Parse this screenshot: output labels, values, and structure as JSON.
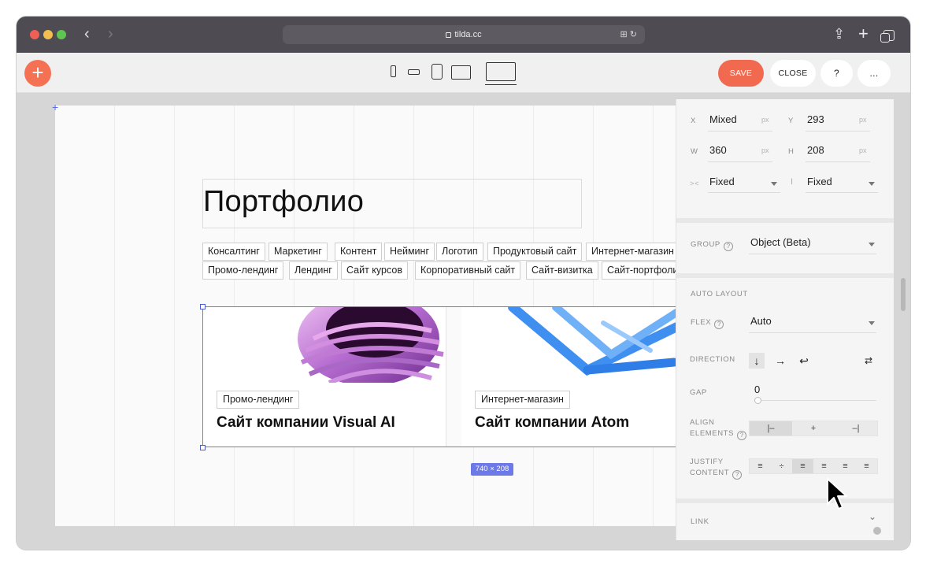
{
  "browser": {
    "url": "tilda.cc",
    "back_glyph": "‹",
    "forward_glyph": "›",
    "right_icons": "⊞ ↻",
    "share_glyph": "⇪",
    "newtab_glyph": "+"
  },
  "toolbar": {
    "add_glyph": "+",
    "save_label": "SAVE",
    "close_label": "CLOSE",
    "help_label": "?",
    "more_label": "...",
    "accent_color": "#f16a50",
    "devices": [
      "phone-icon",
      "phone-landscape-icon",
      "tablet-icon",
      "tablet-landscape-icon",
      "desktop-icon"
    ]
  },
  "canvas": {
    "corner_marker": "+",
    "heading": "Портфолио",
    "tags_row1": [
      "Консалтинг",
      "Маркетинг",
      "Контент",
      "Нейминг",
      "Логотип",
      "Продуктовый сайт",
      "Интернет-магазин"
    ],
    "tags_row2": [
      "Промо-лендинг",
      "Лендинг",
      "Сайт курсов",
      "Корпоративный сайт",
      "Сайт-визитка",
      "Сайт-портфолио"
    ],
    "cards": [
      {
        "tag": "Промо-лендинг",
        "title": "Сайт компании Visual AI"
      },
      {
        "tag": "Интернет-магазин",
        "title": "Сайт компании Atom"
      }
    ],
    "selection_size": "740 × 208",
    "selection_color": "#6c79e6"
  },
  "panel": {
    "x_label": "X",
    "x_value": "Mixed",
    "x_unit": "px",
    "y_label": "Y",
    "y_value": "293",
    "y_unit": "px",
    "w_label": "W",
    "w_value": "360",
    "w_unit": "px",
    "h_label": "H",
    "h_value": "208",
    "h_unit": "px",
    "width_mode": "Fixed",
    "height_mode": "Fixed",
    "group_label": "GROUP",
    "group_value": "Object (Beta)",
    "auto_layout_label": "AUTO LAYOUT",
    "flex_label": "FLEX",
    "flex_value": "Auto",
    "direction_label": "DIRECTION",
    "direction_icons": [
      "↓",
      "→",
      "↩",
      "⇄"
    ],
    "gap_label": "GAP",
    "gap_value": "0",
    "align_label_1": "ALIGN",
    "align_label_2": "ELEMENTS",
    "align_icons": [
      "|–",
      "+",
      "–|"
    ],
    "justify_label_1": "JUSTIFY",
    "justify_label_2": "CONTENT",
    "justify_icons": [
      "≡",
      "÷",
      "≡",
      "≡",
      "≡",
      "≡"
    ],
    "link_label": "LINK",
    "q": "?"
  }
}
